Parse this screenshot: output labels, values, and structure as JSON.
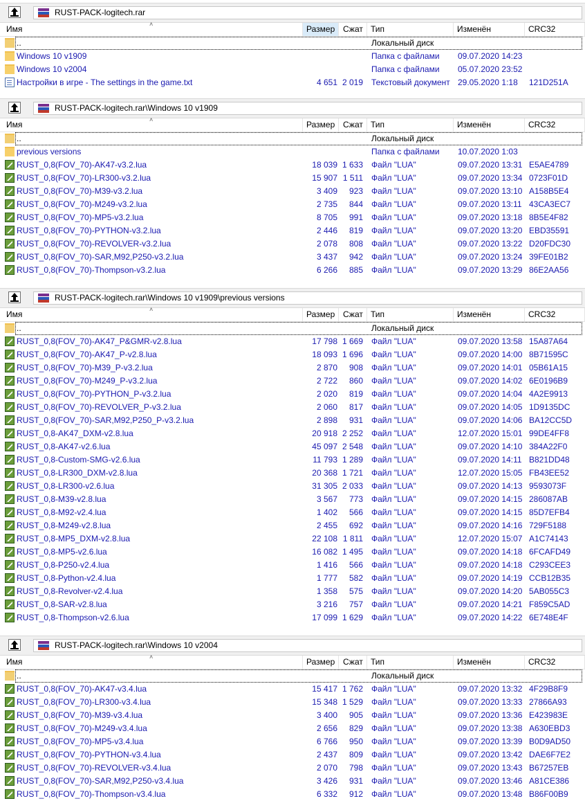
{
  "colors": {
    "link": "#1a1ab0",
    "header_selected": "#d9ebf9",
    "pathbar": "#f0f0f0"
  },
  "columns": {
    "name": "Имя",
    "size": "Размер",
    "packed": "Сжат",
    "type": "Тип",
    "modified": "Изменён",
    "crc": "CRC32"
  },
  "panels": [
    {
      "path": "RUST-PACK-logitech.rar",
      "rows": [
        {
          "icon": "folder-up-icon",
          "name": "..",
          "size": "",
          "packed": "",
          "type": "Локальный диск",
          "modified": "",
          "crc": ""
        },
        {
          "icon": "folder-icon",
          "name": "Windows 10 v1909",
          "size": "",
          "packed": "",
          "type": "Папка с файлами",
          "modified": "09.07.2020 14:23",
          "crc": ""
        },
        {
          "icon": "folder-icon",
          "name": "Windows 10 v2004",
          "size": "",
          "packed": "",
          "type": "Папка с файлами",
          "modified": "05.07.2020 23:52",
          "crc": ""
        },
        {
          "icon": "text-file-icon",
          "name": "Настройки в игре - The settings in the game.txt",
          "size": "4 651",
          "packed": "2 019",
          "type": "Текстовый документ",
          "modified": "29.05.2020 1:18",
          "crc": "121D251A"
        }
      ]
    },
    {
      "path": "RUST-PACK-logitech.rar\\Windows 10 v1909",
      "rows": [
        {
          "icon": "folder-up-icon",
          "name": "..",
          "size": "",
          "packed": "",
          "type": "Локальный диск",
          "modified": "",
          "crc": ""
        },
        {
          "icon": "folder-icon",
          "name": "previous versions",
          "size": "",
          "packed": "",
          "type": "Папка с файлами",
          "modified": "10.07.2020 1:03",
          "crc": ""
        },
        {
          "icon": "lua-file-icon",
          "name": "RUST_0,8(FOV_70)-AK47-v3.2.lua",
          "size": "18 039",
          "packed": "1 633",
          "type": "Файл \"LUA\"",
          "modified": "09.07.2020 13:31",
          "crc": "E5AE4789"
        },
        {
          "icon": "lua-file-icon",
          "name": "RUST_0,8(FOV_70)-LR300-v3.2.lua",
          "size": "15 907",
          "packed": "1 511",
          "type": "Файл \"LUA\"",
          "modified": "09.07.2020 13:34",
          "crc": "0723F01D"
        },
        {
          "icon": "lua-file-icon",
          "name": "RUST_0,8(FOV_70)-M39-v3.2.lua",
          "size": "3 409",
          "packed": "923",
          "type": "Файл \"LUA\"",
          "modified": "09.07.2020 13:10",
          "crc": "A158B5E4"
        },
        {
          "icon": "lua-file-icon",
          "name": "RUST_0,8(FOV_70)-M249-v3.2.lua",
          "size": "2 735",
          "packed": "844",
          "type": "Файл \"LUA\"",
          "modified": "09.07.2020 13:11",
          "crc": "43CA3EC7"
        },
        {
          "icon": "lua-file-icon",
          "name": "RUST_0,8(FOV_70)-MP5-v3.2.lua",
          "size": "8 705",
          "packed": "991",
          "type": "Файл \"LUA\"",
          "modified": "09.07.2020 13:18",
          "crc": "8B5E4F82"
        },
        {
          "icon": "lua-file-icon",
          "name": "RUST_0,8(FOV_70)-PYTHON-v3.2.lua",
          "size": "2 446",
          "packed": "819",
          "type": "Файл \"LUA\"",
          "modified": "09.07.2020 13:20",
          "crc": "EBD35591"
        },
        {
          "icon": "lua-file-icon",
          "name": "RUST_0,8(FOV_70)-REVOLVER-v3.2.lua",
          "size": "2 078",
          "packed": "808",
          "type": "Файл \"LUA\"",
          "modified": "09.07.2020 13:22",
          "crc": "D20FDC30"
        },
        {
          "icon": "lua-file-icon",
          "name": "RUST_0,8(FOV_70)-SAR,M92,P250-v3.2.lua",
          "size": "3 437",
          "packed": "942",
          "type": "Файл \"LUA\"",
          "modified": "09.07.2020 13:24",
          "crc": "39FE01B2"
        },
        {
          "icon": "lua-file-icon",
          "name": "RUST_0,8(FOV_70)-Thompson-v3.2.lua",
          "size": "6 266",
          "packed": "885",
          "type": "Файл \"LUA\"",
          "modified": "09.07.2020 13:29",
          "crc": "86E2AA56"
        }
      ]
    },
    {
      "path": "RUST-PACK-logitech.rar\\Windows 10 v1909\\previous versions",
      "rows": [
        {
          "icon": "folder-up-icon",
          "name": "..",
          "size": "",
          "packed": "",
          "type": "Локальный диск",
          "modified": "",
          "crc": ""
        },
        {
          "icon": "lua-file-icon",
          "name": "RUST_0,8(FOV_70)-AK47_P&GMR-v2.8.lua",
          "size": "17 798",
          "packed": "1 669",
          "type": "Файл \"LUA\"",
          "modified": "09.07.2020 13:58",
          "crc": "15A87A64"
        },
        {
          "icon": "lua-file-icon",
          "name": "RUST_0,8(FOV_70)-AK47_P-v2.8.lua",
          "size": "18 093",
          "packed": "1 696",
          "type": "Файл \"LUA\"",
          "modified": "09.07.2020 14:00",
          "crc": "8B71595C"
        },
        {
          "icon": "lua-file-icon",
          "name": "RUST_0,8(FOV_70)-M39_P-v3.2.lua",
          "size": "2 870",
          "packed": "908",
          "type": "Файл \"LUA\"",
          "modified": "09.07.2020 14:01",
          "crc": "05B61A15"
        },
        {
          "icon": "lua-file-icon",
          "name": "RUST_0,8(FOV_70)-M249_P-v3.2.lua",
          "size": "2 722",
          "packed": "860",
          "type": "Файл \"LUA\"",
          "modified": "09.07.2020 14:02",
          "crc": "6E0196B9"
        },
        {
          "icon": "lua-file-icon",
          "name": "RUST_0,8(FOV_70)-PYTHON_P-v3.2.lua",
          "size": "2 020",
          "packed": "819",
          "type": "Файл \"LUA\"",
          "modified": "09.07.2020 14:04",
          "crc": "4A2E9913"
        },
        {
          "icon": "lua-file-icon",
          "name": "RUST_0,8(FOV_70)-REVOLVER_P-v3.2.lua",
          "size": "2 060",
          "packed": "817",
          "type": "Файл \"LUA\"",
          "modified": "09.07.2020 14:05",
          "crc": "1D9135DC"
        },
        {
          "icon": "lua-file-icon",
          "name": "RUST_0,8(FOV_70)-SAR,M92,P250_P-v3.2.lua",
          "size": "2 898",
          "packed": "931",
          "type": "Файл \"LUA\"",
          "modified": "09.07.2020 14:06",
          "crc": "BA12CC5D"
        },
        {
          "icon": "lua-file-icon",
          "name": "RUST_0,8-AK47_DXM-v2.8.lua",
          "size": "20 918",
          "packed": "2 252",
          "type": "Файл \"LUA\"",
          "modified": "12.07.2020 15:01",
          "crc": "99DE4FF8"
        },
        {
          "icon": "lua-file-icon",
          "name": "RUST_0,8-AK47-v2.6.lua",
          "size": "45 097",
          "packed": "2 548",
          "type": "Файл \"LUA\"",
          "modified": "09.07.2020 14:10",
          "crc": "384A22F0"
        },
        {
          "icon": "lua-file-icon",
          "name": "RUST_0,8-Custom-SMG-v2.6.lua",
          "size": "11 793",
          "packed": "1 289",
          "type": "Файл \"LUA\"",
          "modified": "09.07.2020 14:11",
          "crc": "B821DD48"
        },
        {
          "icon": "lua-file-icon",
          "name": "RUST_0,8-LR300_DXM-v2.8.lua",
          "size": "20 368",
          "packed": "1 721",
          "type": "Файл \"LUA\"",
          "modified": "12.07.2020 15:05",
          "crc": "FB43EE52"
        },
        {
          "icon": "lua-file-icon",
          "name": "RUST_0,8-LR300-v2.6.lua",
          "size": "31 305",
          "packed": "2 033",
          "type": "Файл \"LUA\"",
          "modified": "09.07.2020 14:13",
          "crc": "9593073F"
        },
        {
          "icon": "lua-file-icon",
          "name": "RUST_0,8-M39-v2.8.lua",
          "size": "3 567",
          "packed": "773",
          "type": "Файл \"LUA\"",
          "modified": "09.07.2020 14:15",
          "crc": "286087AB"
        },
        {
          "icon": "lua-file-icon",
          "name": "RUST_0,8-M92-v2.4.lua",
          "size": "1 402",
          "packed": "566",
          "type": "Файл \"LUA\"",
          "modified": "09.07.2020 14:15",
          "crc": "85D7EFB4"
        },
        {
          "icon": "lua-file-icon",
          "name": "RUST_0,8-M249-v2.8.lua",
          "size": "2 455",
          "packed": "692",
          "type": "Файл \"LUA\"",
          "modified": "09.07.2020 14:16",
          "crc": "729F5188"
        },
        {
          "icon": "lua-file-icon",
          "name": "RUST_0,8-MP5_DXM-v2.8.lua",
          "size": "22 108",
          "packed": "1 811",
          "type": "Файл \"LUA\"",
          "modified": "12.07.2020 15:07",
          "crc": "A1C74143"
        },
        {
          "icon": "lua-file-icon",
          "name": "RUST_0,8-MP5-v2.6.lua",
          "size": "16 082",
          "packed": "1 495",
          "type": "Файл \"LUA\"",
          "modified": "09.07.2020 14:18",
          "crc": "6FCAFD49"
        },
        {
          "icon": "lua-file-icon",
          "name": "RUST_0,8-P250-v2.4.lua",
          "size": "1 416",
          "packed": "566",
          "type": "Файл \"LUA\"",
          "modified": "09.07.2020 14:18",
          "crc": "C293CEE3"
        },
        {
          "icon": "lua-file-icon",
          "name": "RUST_0,8-Python-v2.4.lua",
          "size": "1 777",
          "packed": "582",
          "type": "Файл \"LUA\"",
          "modified": "09.07.2020 14:19",
          "crc": "CCB12B35"
        },
        {
          "icon": "lua-file-icon",
          "name": "RUST_0,8-Revolver-v2.4.lua",
          "size": "1 358",
          "packed": "575",
          "type": "Файл \"LUA\"",
          "modified": "09.07.2020 14:20",
          "crc": "5AB055C3"
        },
        {
          "icon": "lua-file-icon",
          "name": "RUST_0,8-SAR-v2.8.lua",
          "size": "3 216",
          "packed": "757",
          "type": "Файл \"LUA\"",
          "modified": "09.07.2020 14:21",
          "crc": "F859C5AD"
        },
        {
          "icon": "lua-file-icon",
          "name": "RUST_0,8-Thompson-v2.6.lua",
          "size": "17 099",
          "packed": "1 629",
          "type": "Файл \"LUA\"",
          "modified": "09.07.2020 14:22",
          "crc": "6E748E4F"
        }
      ]
    },
    {
      "path": "RUST-PACK-logitech.rar\\Windows 10 v2004",
      "rows": [
        {
          "icon": "folder-up-icon",
          "name": "..",
          "size": "",
          "packed": "",
          "type": "Локальный диск",
          "modified": "",
          "crc": ""
        },
        {
          "icon": "lua-file-icon",
          "name": "RUST_0,8(FOV_70)-AK47-v3.4.lua",
          "size": "15 417",
          "packed": "1 762",
          "type": "Файл \"LUA\"",
          "modified": "09.07.2020 13:32",
          "crc": "4F29B8F9"
        },
        {
          "icon": "lua-file-icon",
          "name": "RUST_0,8(FOV_70)-LR300-v3.4.lua",
          "size": "15 348",
          "packed": "1 529",
          "type": "Файл \"LUA\"",
          "modified": "09.07.2020 13:33",
          "crc": "27866A93"
        },
        {
          "icon": "lua-file-icon",
          "name": "RUST_0,8(FOV_70)-M39-v3.4.lua",
          "size": "3 400",
          "packed": "905",
          "type": "Файл \"LUA\"",
          "modified": "09.07.2020 13:36",
          "crc": "E423983E"
        },
        {
          "icon": "lua-file-icon",
          "name": "RUST_0,8(FOV_70)-M249-v3.4.lua",
          "size": "2 656",
          "packed": "829",
          "type": "Файл \"LUA\"",
          "modified": "09.07.2020 13:38",
          "crc": "A630EBD3"
        },
        {
          "icon": "lua-file-icon",
          "name": "RUST_0,8(FOV_70)-MP5-v3.4.lua",
          "size": "6 766",
          "packed": "950",
          "type": "Файл \"LUA\"",
          "modified": "09.07.2020 13:39",
          "crc": "B0D9AD50"
        },
        {
          "icon": "lua-file-icon",
          "name": "RUST_0,8(FOV_70)-PYTHON-v3.4.lua",
          "size": "2 437",
          "packed": "809",
          "type": "Файл \"LUA\"",
          "modified": "09.07.2020 13:42",
          "crc": "DAE6F7E2"
        },
        {
          "icon": "lua-file-icon",
          "name": "RUST_0,8(FOV_70)-REVOLVER-v3.4.lua",
          "size": "2 070",
          "packed": "798",
          "type": "Файл \"LUA\"",
          "modified": "09.07.2020 13:43",
          "crc": "B67257EB"
        },
        {
          "icon": "lua-file-icon",
          "name": "RUST_0,8(FOV_70)-SAR,M92,P250-v3.4.lua",
          "size": "3 426",
          "packed": "931",
          "type": "Файл \"LUA\"",
          "modified": "09.07.2020 13:46",
          "crc": "A81CE386"
        },
        {
          "icon": "lua-file-icon",
          "name": "RUST_0,8(FOV_70)-Thompson-v3.4.lua",
          "size": "6 332",
          "packed": "912",
          "type": "Файл \"LUA\"",
          "modified": "09.07.2020 13:48",
          "crc": "B86F00B9"
        }
      ]
    }
  ]
}
